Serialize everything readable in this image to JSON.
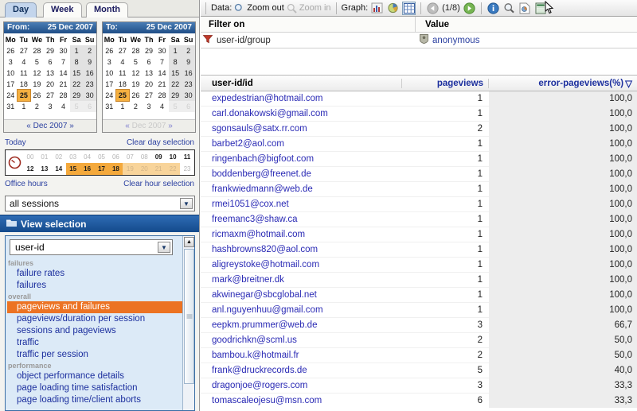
{
  "tabs": [
    {
      "label": "Day",
      "active": true
    },
    {
      "label": "Week",
      "active": false
    },
    {
      "label": "Month",
      "active": false
    }
  ],
  "calendars": {
    "from": {
      "label": "From:",
      "date": "25 Dec 2007",
      "weekdays": [
        "Mo",
        "Tu",
        "We",
        "Th",
        "Fr",
        "Sa",
        "Su"
      ],
      "footer": "Dec 2007",
      "prev": "«",
      "next": "»",
      "dim": false
    },
    "to": {
      "label": "To:",
      "date": "25 Dec 2007",
      "weekdays": [
        "Mo",
        "Tu",
        "We",
        "Th",
        "Fr",
        "Sa",
        "Su"
      ],
      "footer": "Dec 2007",
      "prev": "«",
      "next": "»",
      "dim": true
    },
    "selected_day": 25,
    "weeks": [
      [
        {
          "d": 26,
          "out": true
        },
        {
          "d": 27,
          "out": true
        },
        {
          "d": 28,
          "out": true
        },
        {
          "d": 29,
          "out": true
        },
        {
          "d": 30,
          "out": true
        },
        {
          "d": 1,
          "we": true
        },
        {
          "d": 2,
          "we": true
        }
      ],
      [
        {
          "d": 3
        },
        {
          "d": 4
        },
        {
          "d": 5
        },
        {
          "d": 6
        },
        {
          "d": 7
        },
        {
          "d": 8,
          "we": true
        },
        {
          "d": 9,
          "we": true
        }
      ],
      [
        {
          "d": 10
        },
        {
          "d": 11
        },
        {
          "d": 12
        },
        {
          "d": 13
        },
        {
          "d": 14
        },
        {
          "d": 15,
          "we": true
        },
        {
          "d": 16,
          "we": true
        }
      ],
      [
        {
          "d": 17
        },
        {
          "d": 18
        },
        {
          "d": 19
        },
        {
          "d": 20
        },
        {
          "d": 21
        },
        {
          "d": 22,
          "we": true
        },
        {
          "d": 23,
          "we": true
        }
      ],
      [
        {
          "d": 24
        },
        {
          "d": 25,
          "sel": true
        },
        {
          "d": 26
        },
        {
          "d": 27
        },
        {
          "d": 28
        },
        {
          "d": 29,
          "we": true
        },
        {
          "d": 30,
          "we": true
        }
      ],
      [
        {
          "d": 31
        },
        {
          "d": 1,
          "out": true
        },
        {
          "d": 2,
          "out": true
        },
        {
          "d": 3,
          "out": true
        },
        {
          "d": 4,
          "out": true
        },
        {
          "d": 5,
          "out": true,
          "we": true
        },
        {
          "d": 6,
          "out": true,
          "we": true
        }
      ]
    ]
  },
  "day_links": {
    "today": "Today",
    "clear_day": "Clear day selection"
  },
  "hour_links": {
    "office": "Office hours",
    "clear_hour": "Clear hour selection"
  },
  "hours": [
    {
      "h": "00",
      "state": "dim"
    },
    {
      "h": "01",
      "state": "dim"
    },
    {
      "h": "02",
      "state": "dim"
    },
    {
      "h": "03",
      "state": "dim"
    },
    {
      "h": "04",
      "state": "dim"
    },
    {
      "h": "05",
      "state": "dim"
    },
    {
      "h": "06",
      "state": "dim"
    },
    {
      "h": "07",
      "state": "dim"
    },
    {
      "h": "08",
      "state": "dim"
    },
    {
      "h": "09",
      "state": "lit"
    },
    {
      "h": "10",
      "state": "lit"
    },
    {
      "h": "11",
      "state": "lit"
    },
    {
      "h": "12",
      "state": "lit"
    },
    {
      "h": "13",
      "state": "lit"
    },
    {
      "h": "14",
      "state": "lit"
    },
    {
      "h": "15",
      "state": "sel"
    },
    {
      "h": "16",
      "state": "sel"
    },
    {
      "h": "17",
      "state": "sel"
    },
    {
      "h": "18",
      "state": "sel"
    },
    {
      "h": "19",
      "state": "selpale"
    },
    {
      "h": "20",
      "state": "selpale"
    },
    {
      "h": "21",
      "state": "selpale"
    },
    {
      "h": "22",
      "state": "selpale"
    },
    {
      "h": "23",
      "state": "dim"
    }
  ],
  "session_select": {
    "value": "all sessions"
  },
  "view_panel": {
    "title": "View selection",
    "dimension_value": "user-id",
    "groups": [
      {
        "name": "failures",
        "items": [
          {
            "label": "failure rates"
          },
          {
            "label": "failures"
          }
        ]
      },
      {
        "name": "overall",
        "items": [
          {
            "label": "pageviews and failures",
            "selected": true
          },
          {
            "label": "pageviews/duration per session"
          },
          {
            "label": "sessions and pageviews"
          },
          {
            "label": "traffic"
          },
          {
            "label": "traffic per session"
          }
        ]
      },
      {
        "name": "performance",
        "items": [
          {
            "label": "object performance details"
          },
          {
            "label": "page loading time satisfaction"
          },
          {
            "label": "page loading time/client aborts"
          }
        ]
      }
    ]
  },
  "toolbar": {
    "data_label": "Data:",
    "zoom_out": "Zoom out",
    "zoom_in": "Zoom in",
    "graph_label": "Graph:",
    "page_indicator": "(1/8)",
    "icons": {
      "zoom_out": "magnifier-icon",
      "zoom_in": "magnifier-icon",
      "bar": "bar-chart-icon",
      "pie": "pie-chart-icon",
      "table": "table-icon",
      "prev": "previous-page-icon",
      "next": "next-page-icon",
      "info": "info-icon",
      "inspect": "magnifier-icon",
      "report": "report-icon",
      "export": "excel-export-icon"
    }
  },
  "filter": {
    "col_filter": "Filter on",
    "col_value": "Value",
    "rows": [
      {
        "filter": "user-id/group",
        "value": "anonymous"
      }
    ]
  },
  "table": {
    "columns": [
      "user-id/id",
      "pageviews",
      "error-pageviews(%)"
    ],
    "sort_arrow": "▽",
    "rows": [
      {
        "id": "expedestrian@hotmail.com",
        "pageviews": "1",
        "error": "100,0"
      },
      {
        "id": "carl.donakowski@gmail.com",
        "pageviews": "1",
        "error": "100,0"
      },
      {
        "id": "sgonsauls@satx.rr.com",
        "pageviews": "2",
        "error": "100,0"
      },
      {
        "id": "barbet2@aol.com",
        "pageviews": "1",
        "error": "100,0"
      },
      {
        "id": "ringenbach@bigfoot.com",
        "pageviews": "1",
        "error": "100,0"
      },
      {
        "id": "boddenberg@freenet.de",
        "pageviews": "1",
        "error": "100,0"
      },
      {
        "id": "frankwiedmann@web.de",
        "pageviews": "1",
        "error": "100,0"
      },
      {
        "id": "rmei1051@cox.net",
        "pageviews": "1",
        "error": "100,0"
      },
      {
        "id": "freemanc3@shaw.ca",
        "pageviews": "1",
        "error": "100,0"
      },
      {
        "id": "ricmaxm@hotmail.com",
        "pageviews": "1",
        "error": "100,0"
      },
      {
        "id": "hashbrowns820@aol.com",
        "pageviews": "1",
        "error": "100,0"
      },
      {
        "id": "aligreystoke@hotmail.com",
        "pageviews": "1",
        "error": "100,0"
      },
      {
        "id": "mark@breitner.dk",
        "pageviews": "1",
        "error": "100,0"
      },
      {
        "id": "akwinegar@sbcglobal.net",
        "pageviews": "1",
        "error": "100,0"
      },
      {
        "id": "anl.nguyenhuu@gmail.com",
        "pageviews": "1",
        "error": "100,0"
      },
      {
        "id": "eepkm.prummer@web.de",
        "pageviews": "3",
        "error": "66,7"
      },
      {
        "id": "goodrichkn@scml.us",
        "pageviews": "2",
        "error": "50,0"
      },
      {
        "id": "bambou.k@hotmail.fr",
        "pageviews": "2",
        "error": "50,0"
      },
      {
        "id": "frank@druckrecords.de",
        "pageviews": "5",
        "error": "40,0"
      },
      {
        "id": "dragonjoe@rogers.com",
        "pageviews": "3",
        "error": "33,3"
      },
      {
        "id": "tomascaleojesu@msn.com",
        "pageviews": "6",
        "error": "33,3"
      }
    ]
  },
  "colors": {
    "accent_orange": "#ec7323",
    "selected_day": "#f5b040",
    "link_blue": "#2a2ab5",
    "header_blue": "#1c2f9e",
    "panel_blue": "#134a8c"
  }
}
